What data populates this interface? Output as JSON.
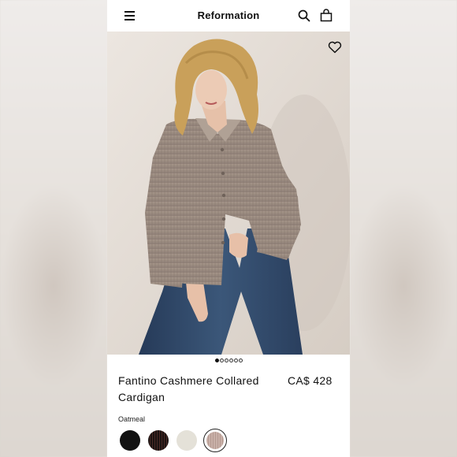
{
  "header": {
    "brand": "Reformation",
    "menu_icon": "hamburger-menu-icon",
    "search_icon": "search-icon",
    "bag_icon": "shopping-bag-icon"
  },
  "hero": {
    "favorite_icon": "heart-icon",
    "image_count": 6,
    "active_image_index": 0
  },
  "product": {
    "name": "Fantino Cashmere Collared Cardigan",
    "price": "CA$ 428",
    "selected_color": "Oatmeal",
    "swatches": [
      {
        "color": "#121212",
        "selected": false
      },
      {
        "color": "#2a1c1a",
        "selected": false
      },
      {
        "color": "#e4e1d8",
        "selected": false
      },
      {
        "color": "#c2a8a0",
        "selected": true
      }
    ]
  },
  "colors": {
    "background": "#ffffff",
    "text": "#111111",
    "cardigan": "#9c8d84",
    "jeans": "#2f4768"
  }
}
